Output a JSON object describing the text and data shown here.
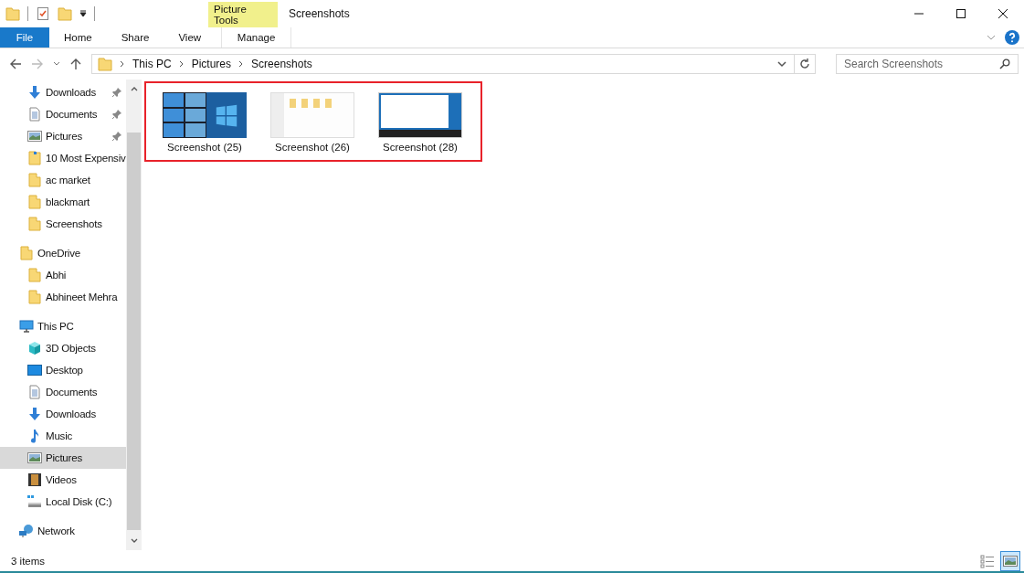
{
  "window": {
    "title": "Screenshots",
    "context_tab_group": "Picture Tools"
  },
  "ribbon_tabs": [
    {
      "label": "File",
      "kind": "file",
      "selected": false
    },
    {
      "label": "Home",
      "kind": "tab",
      "selected": false
    },
    {
      "label": "Share",
      "kind": "tab",
      "selected": false
    },
    {
      "label": "View",
      "kind": "tab",
      "selected": false
    },
    {
      "label": "Manage",
      "kind": "context",
      "selected": false
    }
  ],
  "address": {
    "path": [
      "This PC",
      "Pictures",
      "Screenshots"
    ]
  },
  "search": {
    "placeholder": "Search Screenshots"
  },
  "quick_access": [
    {
      "label": "Downloads",
      "kind": "downloads",
      "pinned": true,
      "selected": false
    },
    {
      "label": "Documents",
      "kind": "documents",
      "pinned": true,
      "selected": false
    },
    {
      "label": "Pictures",
      "kind": "pictures",
      "pinned": true,
      "selected": false
    },
    {
      "label": "10 Most Expensiv",
      "kind": "shortcut",
      "pinned": false,
      "selected": false
    },
    {
      "label": "ac market",
      "kind": "folder",
      "pinned": false,
      "selected": false
    },
    {
      "label": "blackmart",
      "kind": "folder",
      "pinned": false,
      "selected": false
    },
    {
      "label": "Screenshots",
      "kind": "folder",
      "pinned": false,
      "selected": false
    }
  ],
  "tree": [
    {
      "label": "OneDrive",
      "kind": "folder",
      "selected": false,
      "children": [
        {
          "label": "Abhi",
          "kind": "folder",
          "selected": false
        },
        {
          "label": "Abhineet Mehra",
          "kind": "folder",
          "selected": false
        }
      ]
    },
    {
      "label": "This PC",
      "kind": "pc",
      "selected": false,
      "children": [
        {
          "label": "3D Objects",
          "kind": "objects3d",
          "selected": false
        },
        {
          "label": "Desktop",
          "kind": "desktop",
          "selected": false
        },
        {
          "label": "Documents",
          "kind": "documents",
          "selected": false
        },
        {
          "label": "Downloads",
          "kind": "downloads",
          "selected": false
        },
        {
          "label": "Music",
          "kind": "music",
          "selected": false
        },
        {
          "label": "Pictures",
          "kind": "pictures",
          "selected": true
        },
        {
          "label": "Videos",
          "kind": "videos",
          "selected": false
        },
        {
          "label": "Local Disk (C:)",
          "kind": "disk",
          "selected": false
        }
      ]
    },
    {
      "label": "Network",
      "kind": "network",
      "selected": false
    }
  ],
  "files": [
    {
      "name": "Screenshot (25)",
      "kind": "tiles"
    },
    {
      "name": "Screenshot (26)",
      "kind": "window"
    },
    {
      "name": "Screenshot (28)",
      "kind": "desktop"
    }
  ],
  "status_bar": {
    "item_count": "3 items"
  }
}
